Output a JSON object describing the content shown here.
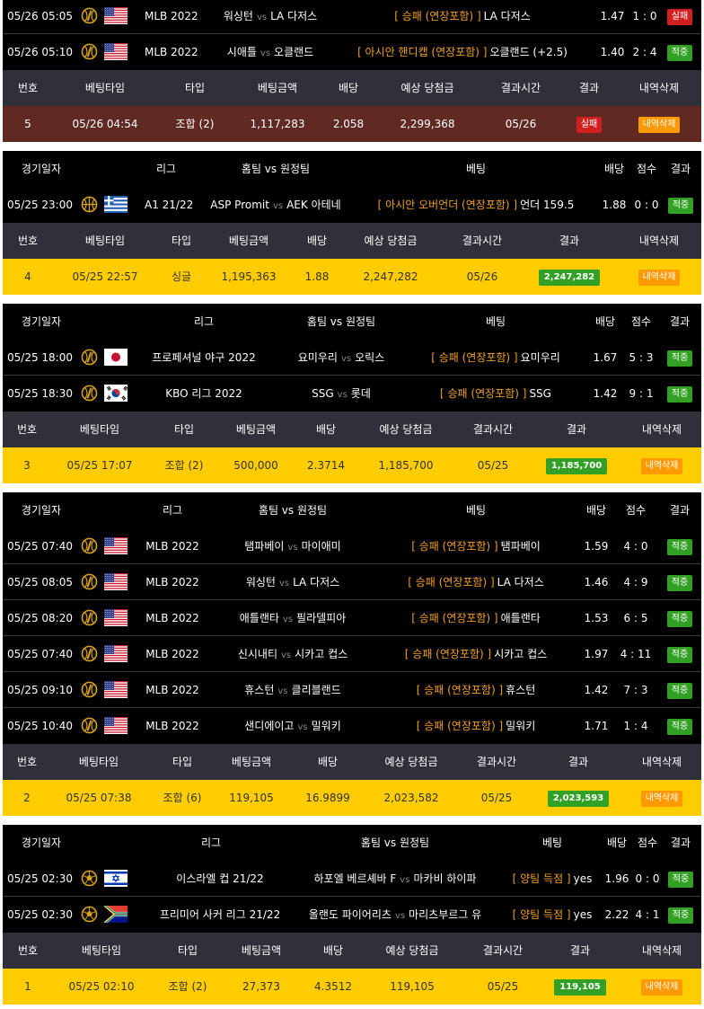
{
  "colors": {
    "page": "#ffffff",
    "table_bg": "#000000",
    "header_bg": "#2f3039",
    "lost_row": "#602a22",
    "won_row": "#ffcc00",
    "badge_win": "#32a024",
    "badge_lose": "#d02020",
    "badge_delete": "#ff9900",
    "accent_text": "#f0a020"
  },
  "game_headers": {
    "date": "경기일자",
    "league": "리그",
    "teams": "홈팀 vs 원정팀",
    "bet": "베팅",
    "odds": "배당",
    "score": "점수",
    "result": "결과"
  },
  "bet_headers": {
    "no": "번호",
    "time": "베팅타임",
    "type": "타입",
    "amount": "베팅금액",
    "odds": "배당",
    "expected": "예상 당첨금",
    "result_time": "결과시간",
    "result": "결과",
    "delete": "내역삭제"
  },
  "vs_text": "vs",
  "groups": [
    {
      "games": [
        {
          "date": "05/26 05:05",
          "sport": "baseball-icon",
          "flag": "flag-usa",
          "league": "MLB 2022",
          "home": "워싱턴",
          "away": "LA 다저스",
          "pick_market": "[ 승패 (연장포함) ]",
          "pick_choice": "LA 다저스",
          "odds": "1.47",
          "score": "1 : 0",
          "result": "실패"
        },
        {
          "date": "05/26 05:10",
          "sport": "baseball-icon",
          "flag": "flag-usa",
          "league": "MLB 2022",
          "home": "시애틀",
          "away": "오클랜드",
          "pick_market": "[ 아시안 핸디캡 (연장포함) ]",
          "pick_choice": "오클랜드 (+2.5)",
          "odds": "1.40",
          "score": "2 : 4",
          "result": "적중"
        }
      ],
      "bet": {
        "no": "5",
        "time": "05/26 04:54",
        "type": "조합 (2)",
        "amount": "1,117,283",
        "odds": "2.058",
        "expected": "2,299,368",
        "result_time": "05/26",
        "result": "실패",
        "delete": "내역삭제"
      }
    },
    {
      "games": [
        {
          "date": "05/25 23:00",
          "sport": "basketball-icon",
          "flag": "flag-greece",
          "league": "A1 21/22",
          "home": "ASP Promit",
          "away": "AEK 아테네",
          "pick_market": "[ 아시안 오버언더 (연장포함) ]",
          "pick_choice": "언더 159.5",
          "odds": "1.88",
          "score": "0 : 0",
          "result": "적중"
        }
      ],
      "bet": {
        "no": "4",
        "time": "05/25 22:57",
        "type": "싱글",
        "amount": "1,195,363",
        "odds": "1.88",
        "expected": "2,247,282",
        "result_time": "05/26",
        "result": "2,247,282",
        "delete": "내역삭제"
      }
    },
    {
      "games": [
        {
          "date": "05/25 18:00",
          "sport": "baseball-icon",
          "flag": "flag-japan",
          "league": "프로페셔널 야구 2022",
          "home": "요미우리",
          "away": "오릭스",
          "pick_market": "[ 승패 (연장포함) ]",
          "pick_choice": "요미우리",
          "odds": "1.67",
          "score": "5 : 3",
          "result": "적중"
        },
        {
          "date": "05/25 18:30",
          "sport": "baseball-icon",
          "flag": "flag-korea",
          "league": "KBO 리그 2022",
          "home": "SSG",
          "away": "롯데",
          "pick_market": "[ 승패 (연장포함) ]",
          "pick_choice": "SSG",
          "odds": "1.42",
          "score": "9 : 1",
          "result": "적중"
        }
      ],
      "bet": {
        "no": "3",
        "time": "05/25 17:07",
        "type": "조합 (2)",
        "amount": "500,000",
        "odds": "2.3714",
        "expected": "1,185,700",
        "result_time": "05/25",
        "result": "1,185,700",
        "delete": "내역삭제"
      }
    },
    {
      "games": [
        {
          "date": "05/25 07:40",
          "sport": "baseball-icon",
          "flag": "flag-usa",
          "league": "MLB 2022",
          "home": "탬파베이",
          "away": "마이애미",
          "pick_market": "[ 승패 (연장포함) ]",
          "pick_choice": "탬파베이",
          "odds": "1.59",
          "score": "4 : 0",
          "result": "적중"
        },
        {
          "date": "05/25 08:05",
          "sport": "baseball-icon",
          "flag": "flag-usa",
          "league": "MLB 2022",
          "home": "워싱턴",
          "away": "LA 다저스",
          "pick_market": "[ 승패 (연장포함) ]",
          "pick_choice": "LA 다저스",
          "odds": "1.46",
          "score": "4 : 9",
          "result": "적중"
        },
        {
          "date": "05/25 08:20",
          "sport": "baseball-icon",
          "flag": "flag-usa",
          "league": "MLB 2022",
          "home": "애틀랜타",
          "away": "필라델피아",
          "pick_market": "[ 승패 (연장포함) ]",
          "pick_choice": "애틀랜타",
          "odds": "1.53",
          "score": "6 : 5",
          "result": "적중"
        },
        {
          "date": "05/25 07:40",
          "sport": "baseball-icon",
          "flag": "flag-usa",
          "league": "MLB 2022",
          "home": "신시내티",
          "away": "시카고 컵스",
          "pick_market": "[ 승패 (연장포함) ]",
          "pick_choice": "시카고 컵스",
          "odds": "1.97",
          "score": "4 : 11",
          "result": "적중"
        },
        {
          "date": "05/25 09:10",
          "sport": "baseball-icon",
          "flag": "flag-usa",
          "league": "MLB 2022",
          "home": "휴스턴",
          "away": "클리블랜드",
          "pick_market": "[ 승패 (연장포함) ]",
          "pick_choice": "휴스턴",
          "odds": "1.42",
          "score": "7 : 3",
          "result": "적중"
        },
        {
          "date": "05/25 10:40",
          "sport": "baseball-icon",
          "flag": "flag-usa",
          "league": "MLB 2022",
          "home": "샌디에이고",
          "away": "밀워키",
          "pick_market": "[ 승패 (연장포함) ]",
          "pick_choice": "밀워키",
          "odds": "1.71",
          "score": "1 : 4",
          "result": "적중"
        }
      ],
      "bet": {
        "no": "2",
        "time": "05/25 07:38",
        "type": "조합 (6)",
        "amount": "119,105",
        "odds": "16.9899",
        "expected": "2,023,582",
        "result_time": "05/25",
        "result": "2,023,593",
        "delete": "내역삭제"
      }
    },
    {
      "games": [
        {
          "date": "05/25 02:30",
          "sport": "soccer-icon",
          "flag": "flag-israel",
          "league": "이스라엘 컵 21/22",
          "home": "하포엘 베르셰바 F",
          "away": "마카비 하이파",
          "pick_market": "[ 양팀 득점 ]",
          "pick_choice": "yes",
          "odds": "1.96",
          "score": "0 : 0",
          "result": "적중"
        },
        {
          "date": "05/25 02:30",
          "sport": "soccer-icon",
          "flag": "flag-south-africa",
          "league": "프리미어 사커 리그 21/22",
          "home": "올랜도 파이어리츠",
          "away": "마리츠부르그 유",
          "pick_market": "[ 양팀 득점 ]",
          "pick_choice": "yes",
          "odds": "2.22",
          "score": "4 : 1",
          "result": "적중"
        }
      ],
      "bet": {
        "no": "1",
        "time": "05/25 02:10",
        "type": "조합 (2)",
        "amount": "27,373",
        "odds": "4.3512",
        "expected": "119,105",
        "result_time": "05/25",
        "result": "119,105",
        "delete": "내역삭제"
      }
    }
  ]
}
